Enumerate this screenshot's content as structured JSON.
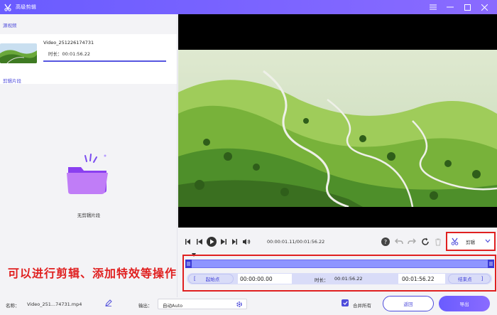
{
  "window": {
    "title": "高级剪辑",
    "buttons": [
      "menu-icon",
      "minimize-icon",
      "maximize-icon",
      "close-icon"
    ]
  },
  "left": {
    "source_label": "源视频",
    "source": {
      "name": "Video_251226174731",
      "duration": "时长：00:01:56.22"
    },
    "clips_label": "剪辑片段",
    "empty_text": "无剪辑片段"
  },
  "controls": {
    "timecode": "00:00:01.11/00:01:56.22",
    "cut_label": "剪辑"
  },
  "timeline": {
    "start_button": "起始点",
    "start_bracket": "[",
    "start_time": "00:00:00.00",
    "duration_label": "时长：",
    "duration_value": "00:01:56.22",
    "end_time": "00:01:56.22",
    "end_button": "结束点",
    "end_bracket": "]"
  },
  "overlay_caption": "可以进行剪辑、添加特效等操作",
  "bottom": {
    "name_label": "名称：",
    "name_value": "Video_251...74731.mp4",
    "output_label": "输出：",
    "output_value": "自动Auto",
    "merge_label": "合并所有",
    "merge_checked": true,
    "return_button": "返回",
    "export_button": "导出"
  },
  "colors": {
    "accent": "#5b54e8",
    "highlight": "#e02020"
  }
}
